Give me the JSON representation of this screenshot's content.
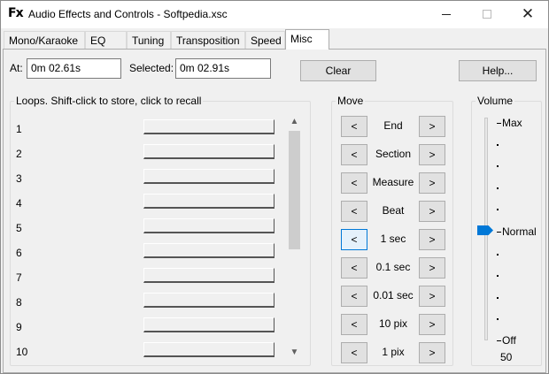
{
  "window": {
    "icon_text": "Fx",
    "title": "Audio Effects and Controls - Softpedia.xsc",
    "min_label": "",
    "max_label": "",
    "close_label": "✕"
  },
  "tabs": [
    {
      "label": "Mono/Karaoke"
    },
    {
      "label": "EQ"
    },
    {
      "label": "Tuning"
    },
    {
      "label": "Transposition"
    },
    {
      "label": "Speed"
    },
    {
      "label": "Misc"
    }
  ],
  "active_tab": "Misc",
  "position": {
    "at_label": "At:",
    "at_value": "0m 02.61s",
    "selected_label": "Selected:",
    "selected_value": "0m 02.91s",
    "clear_label": "Clear",
    "help_label": "Help..."
  },
  "loops": {
    "title": "Loops. Shift-click to store, click to recall",
    "items": [
      "1",
      "2",
      "3",
      "4",
      "5",
      "6",
      "7",
      "8",
      "9",
      "10"
    ]
  },
  "move": {
    "title": "Move",
    "left_glyph": "<",
    "right_glyph": ">",
    "rows": [
      {
        "label": "End"
      },
      {
        "label": "Section"
      },
      {
        "label": "Measure"
      },
      {
        "label": "Beat"
      },
      {
        "label": "1 sec"
      },
      {
        "label": "0.1 sec"
      },
      {
        "label": "0.01 sec"
      },
      {
        "label": "10 pix"
      },
      {
        "label": "1 pix"
      }
    ],
    "focused_row_index": 4
  },
  "volume": {
    "title": "Volume",
    "max_label": "Max",
    "normal_label": "Normal",
    "off_label": "Off",
    "value": "50"
  },
  "scrollbar": {
    "up_glyph": "▲",
    "down_glyph": "▼"
  },
  "colors": {
    "accent": "#0078d7"
  }
}
